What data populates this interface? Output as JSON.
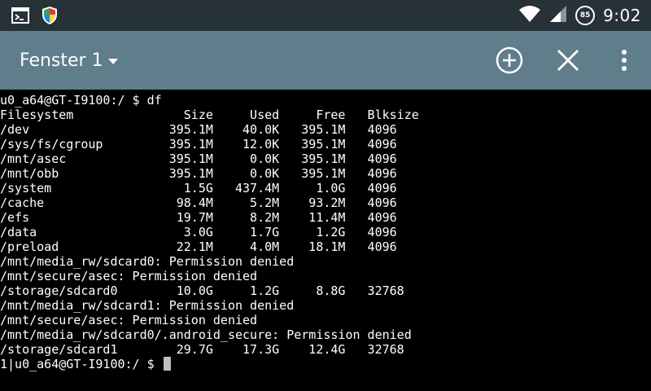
{
  "status_bar": {
    "time": "9:02",
    "battery_level": "85",
    "icons": [
      "terminal-notification-icon",
      "shield-icon",
      "wifi-icon",
      "signal-icon",
      "battery-icon"
    ]
  },
  "app_bar": {
    "title": "Fenster 1",
    "actions": [
      "add-window-icon",
      "close-window-icon",
      "overflow-menu-icon"
    ],
    "background_color": "#607d8b"
  },
  "terminal": {
    "lines": [
      "u0_a64@GT-I9100:/ $ df",
      "Filesystem               Size     Used     Free   Blksize",
      "/dev                   395.1M    40.0K   395.1M   4096",
      "/sys/fs/cgroup         395.1M    12.0K   395.1M   4096",
      "/mnt/asec              395.1M     0.0K   395.1M   4096",
      "/mnt/obb               395.1M     0.0K   395.1M   4096",
      "/system                  1.5G   437.4M     1.0G   4096",
      "/cache                  98.4M     5.2M    93.2M   4096",
      "/efs                    19.7M     8.2M    11.4M   4096",
      "/data                    3.0G     1.7G     1.2G   4096",
      "/preload                22.1M     4.0M    18.1M   4096",
      "/mnt/media_rw/sdcard0: Permission denied",
      "/mnt/secure/asec: Permission denied",
      "/storage/sdcard0        10.0G     1.2G     8.8G   32768",
      "/mnt/media_rw/sdcard1: Permission denied",
      "/mnt/secure/asec: Permission denied",
      "/mnt/media_rw/sdcard0/.android_secure: Permission denied",
      "/storage/sdcard1        29.7G    17.3G    12.4G   32768"
    ],
    "prompt": "1|u0_a64@GT-I9100:/ $ "
  }
}
